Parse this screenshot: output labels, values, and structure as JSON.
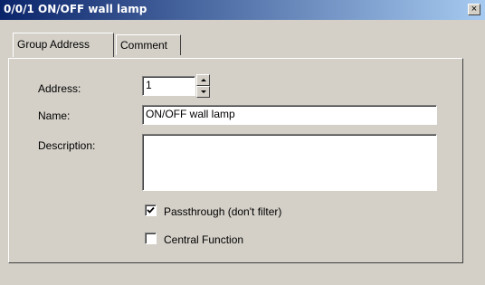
{
  "window": {
    "title": "0/0/1 ON/OFF wall lamp",
    "close_label": "×"
  },
  "tabs": [
    {
      "label": "Group Address",
      "active": true
    },
    {
      "label": "Comment",
      "active": false
    }
  ],
  "form": {
    "address_label": "Address:",
    "address_value": "1",
    "name_label": "Name:",
    "name_value": "ON/OFF wall lamp",
    "description_label": "Description:",
    "description_value": "",
    "passthrough_label": "Passthrough (don't filter)",
    "passthrough_checked": true,
    "central_label": "Central Function",
    "central_checked": false
  }
}
